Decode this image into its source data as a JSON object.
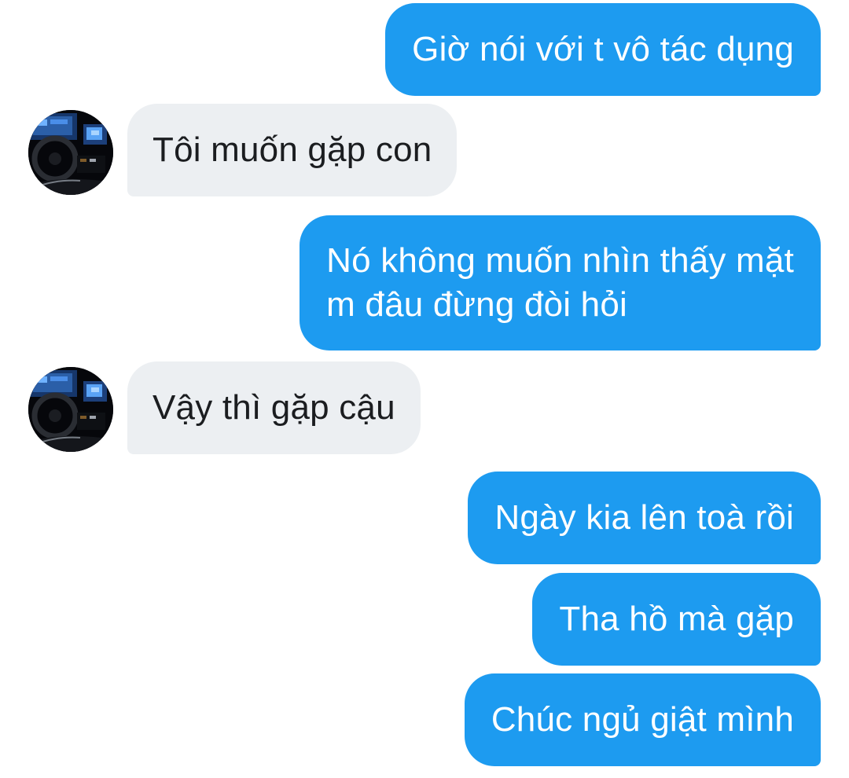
{
  "conversation": {
    "messages": [
      {
        "sender": "me",
        "text": "Giờ nói với t vô tác dụng"
      },
      {
        "sender": "other",
        "text": "Tôi muốn gặp con",
        "avatar": "car-dashboard-avatar"
      },
      {
        "sender": "me",
        "text_lines": [
          "Nó không muốn nhìn thấy mặt",
          "m đâu đừng đòi hỏi"
        ]
      },
      {
        "sender": "other",
        "text": "Vậy thì gặp cậu",
        "avatar": "car-dashboard-avatar"
      },
      {
        "sender": "me",
        "text": "Ngày kia lên toà rồi"
      },
      {
        "sender": "me",
        "text": "Tha hồ mà gặp"
      },
      {
        "sender": "me",
        "text": "Chúc ngủ giật mình"
      }
    ]
  },
  "colors": {
    "sent_bubble": "#1d9bf0",
    "sent_text": "#ffffff",
    "received_bubble": "#eceff2",
    "received_text": "#1b1d20",
    "background": "#ffffff"
  }
}
